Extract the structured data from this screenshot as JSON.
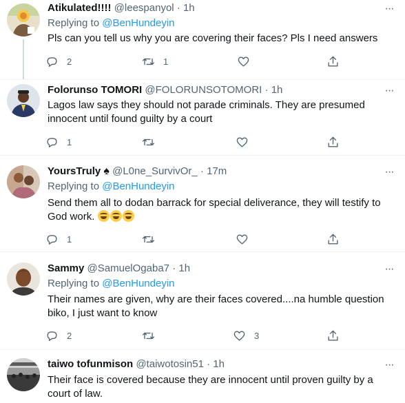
{
  "tweets": [
    {
      "name": "Atikulated!!!!",
      "handle": "@leespanyol",
      "time": "1h",
      "replying_label": "Replying to",
      "replying_handle": "@BenHundeyin",
      "lines": [
        "Pls can you tell us why you are covering their faces? Pls I need answers"
      ],
      "reply_count": "2",
      "retweet_count": "1",
      "like_count": ""
    },
    {
      "name": "Folorunso TOMORI",
      "handle": "@FOLORUNSOTOMORI",
      "time": "1h",
      "lines": [
        "Lagos law says they should not parade criminals. They are presumed",
        "innocent until found guilty by a court"
      ],
      "reply_count": "1",
      "retweet_count": "",
      "like_count": ""
    },
    {
      "name": "YoursTruly",
      "name_badge": "♠",
      "handle": "@L0ne_SurvivOr_",
      "time": "17m",
      "replying_label": "Replying to",
      "replying_handle": "@BenHundeyin",
      "lines": [
        "Send them all to dodan barrack for special deliverance, they will testify to",
        "God work. "
      ],
      "emoji_name": "rolling-on-floor-laughing-emoji",
      "reply_count": "1",
      "retweet_count": "",
      "like_count": ""
    },
    {
      "name": "Sammy",
      "handle": "@SamuelOgaba7",
      "time": "1h",
      "replying_label": "Replying to",
      "replying_handle": "@BenHundeyin",
      "lines": [
        "Their names are given, why are their faces covered....na humble question",
        "biko, I just want to know"
      ],
      "reply_count": "2",
      "retweet_count": "",
      "like_count": "3"
    },
    {
      "name": "taiwo tofunmison",
      "handle": "@taiwotosin51",
      "time": "1h",
      "lines": [
        "Their face is covered because they are innocent until proven guilty by a",
        "court of law."
      ]
    }
  ],
  "separator": "·",
  "icons": {
    "reply": "reply-icon",
    "retweet": "retweet-icon",
    "like": "heart-icon",
    "share": "share-icon",
    "more": "more-icon"
  },
  "colors": {
    "link": "#1d9bf0",
    "secondary": "#536471",
    "text": "#0f1419",
    "divider": "#eff3f4",
    "thread_line": "#cfd9de"
  }
}
